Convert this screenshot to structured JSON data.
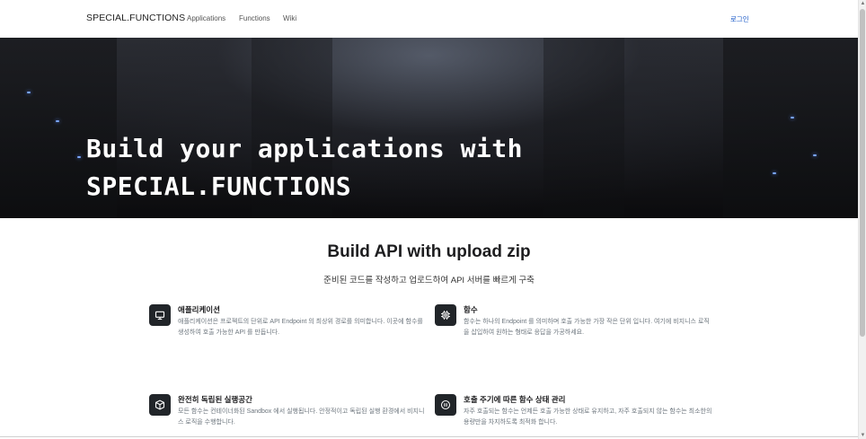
{
  "navbar": {
    "brand": "SPECIAL.FUNCTIONS",
    "links": [
      "Applications",
      "Functions",
      "Wiki"
    ],
    "login": "로그인"
  },
  "hero": {
    "title_line1": "Build your applications with",
    "title_line2": "SPECIAL.FUNCTIONS"
  },
  "section": {
    "title": "Build API with upload zip",
    "subtitle": "준비된 코드를 작성하고 업로드하여 API 서버를 빠르게 구축"
  },
  "features": [
    {
      "icon": "monitor-icon",
      "title": "애플리케이션",
      "desc": "애플리케이션은 프로젝트의 단위로 API Endpoint 의 최상위 경로를 의미합니다. 이곳에 함수를 생성하여 호출 가능한 API 를 만듭니다."
    },
    {
      "icon": "cpu-icon",
      "title": "함수",
      "desc": "함수는 하나의 Endpoint 를 의미하며 호출 가능한 가장 작은 단위 입니다. 여기에 비지니스 로직을 삽입하여 원하는 형태로 응답을 가공하세요."
    },
    {
      "icon": "box-icon",
      "title": "완전히 독립된 실행공간",
      "desc": "모든 함수는 컨테이너화된 Sandbox 에서 실행됩니다. 안정적이고 독립된 실행 환경에서 비지니스 로직을 수행합니다."
    },
    {
      "icon": "pause-circle-icon",
      "title": "호출 주기에 따른 함수 상태 관리",
      "desc": "자주 호출되는 함수는 언제든 호출 가능한 상태로 유지하고, 자주 호출되지 않는 함수는 최소한의 용량만을 차지하도록 최적화 합니다."
    }
  ],
  "colors": {
    "login_link": "#1a58c7",
    "icon_bg": "#212529",
    "hero_bg": "#17181c"
  }
}
